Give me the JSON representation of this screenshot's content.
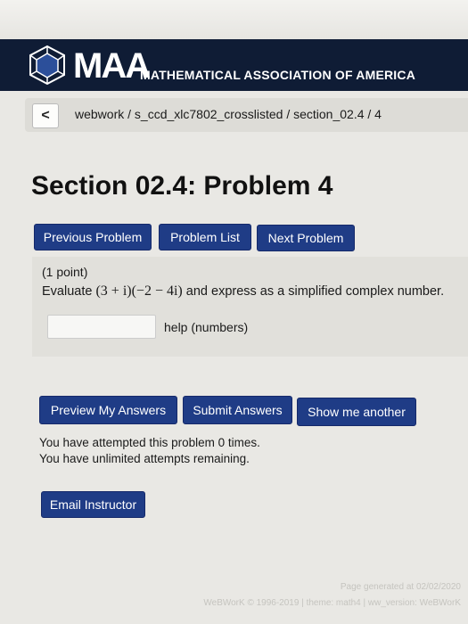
{
  "header": {
    "logo_text": "MAA",
    "association": "MATHEMATICAL ASSOCIATION OF AMERICA",
    "logo_icon": "polyhedron-logo-icon"
  },
  "breadcrumb": {
    "back_icon": "chevron-left-icon",
    "back_glyph": "<",
    "text": "webwork / s_ccd_xlc7802_crosslisted / section_02.4 / 4"
  },
  "page": {
    "title": "Section 02.4: Problem 4"
  },
  "nav": {
    "previous": "Previous Problem",
    "list": "Problem List",
    "next": "Next Problem"
  },
  "problem": {
    "points": "(1 point)",
    "prefix": "Evaluate ",
    "expression": "(3 + i)(−2 − 4i)",
    "suffix": " and express as a simplified complex number.",
    "answer_value": "",
    "help_link": "help (numbers)"
  },
  "actions": {
    "preview": "Preview My Answers",
    "submit": "Submit Answers",
    "show_another": "Show me another"
  },
  "status": {
    "attempted": "You have attempted this problem 0 times.",
    "remaining": "You have unlimited attempts remaining."
  },
  "email_button": "Email Instructor",
  "footer": {
    "generated": "Page generated at 02/02/2020",
    "copyright": "WeBWorK © 1996-2019 | theme: math4 | ww_version: WeBWorK"
  },
  "colors": {
    "header_bg": "#0f1c35",
    "button_bg": "#1f3c86",
    "page_bg": "#e9e8e4"
  }
}
